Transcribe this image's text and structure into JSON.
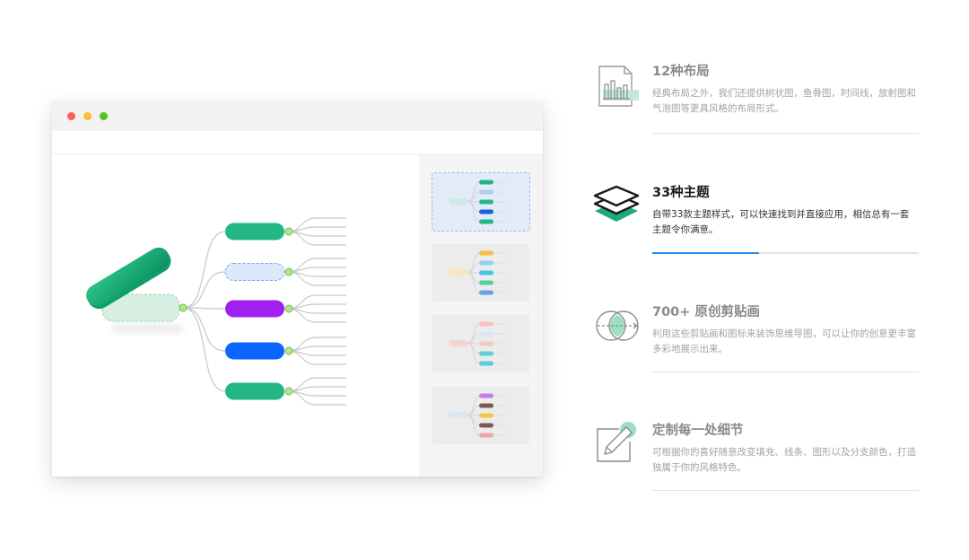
{
  "window": {
    "traffic_lights": [
      "#ff5f57",
      "#febc2e",
      "#52c41a"
    ],
    "mindmap": {
      "root_color": "#0f9d6a",
      "branch_colors": [
        "#22b783",
        "#dde9fb",
        "#a020f0",
        "#0a66ff",
        "#22b783"
      ]
    },
    "theme_thumbnails": [
      {
        "selected": true,
        "colors": [
          "#23b784",
          "#b8c9ef",
          "#28b48e",
          "#1f5fe0",
          "#23b784"
        ]
      },
      {
        "selected": false,
        "colors": [
          "#f5c040",
          "#8cd4e6",
          "#3fc6e0",
          "#58cfa0",
          "#6e9ef0"
        ]
      },
      {
        "selected": false,
        "colors": [
          "#f6c3c1",
          "#dbe3f5",
          "#f4c9c0",
          "#62ced8",
          "#5acbd9"
        ]
      },
      {
        "selected": false,
        "colors": [
          "#c77de8",
          "#7a5a50",
          "#f5c746",
          "#7a5a50",
          "#f2a59e"
        ]
      }
    ]
  },
  "features": [
    {
      "icon": "bar-chart-layout-icon",
      "title": "12种布局",
      "desc": "经典布局之外，我们还提供树状图，鱼骨图，时间线，放射图和气泡图等更具风格的布局形式。",
      "active": false
    },
    {
      "icon": "layers-theme-icon",
      "title": "33种主题",
      "desc": "自带33款主题样式，可以快速找到并直接应用，相信总有一套主题令你满意。",
      "active": true,
      "progress": 0.4
    },
    {
      "icon": "clipart-circles-icon",
      "title": "700+ 原创剪贴画",
      "desc": "利用这些剪贴画和图标来装饰思维导图，可以让你的创意更丰富多彩地展示出来。",
      "active": false
    },
    {
      "icon": "pencil-edit-icon",
      "title": "定制每一处细节",
      "desc": "可根据你的喜好随意改变填充、线条、图形以及分支颜色，打造独属于你的风格特色。",
      "active": false
    }
  ]
}
